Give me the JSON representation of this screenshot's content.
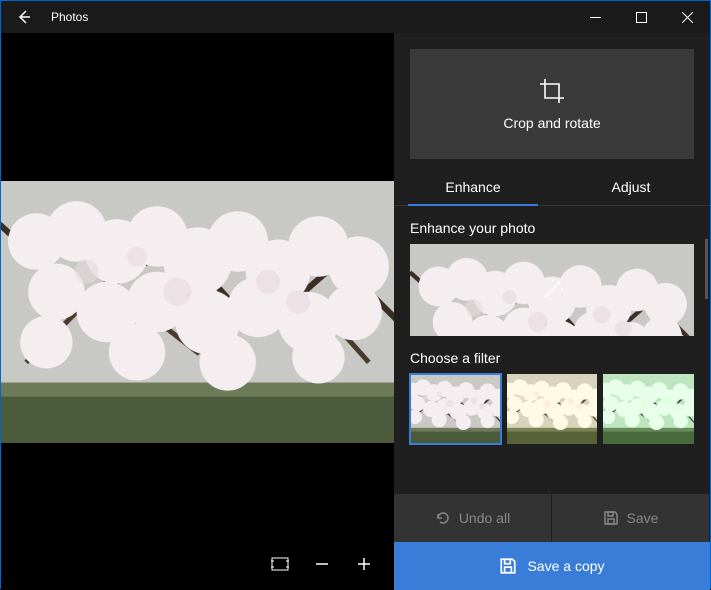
{
  "titlebar": {
    "title": "Photos"
  },
  "panel": {
    "crop_label": "Crop and rotate",
    "tabs": {
      "enhance": "Enhance",
      "adjust": "Adjust",
      "active": "enhance"
    },
    "enhance_section_label": "Enhance your photo",
    "filter_section_label": "Choose a filter",
    "undo_label": "Undo all",
    "save_label": "Save",
    "save_copy_label": "Save a copy"
  }
}
